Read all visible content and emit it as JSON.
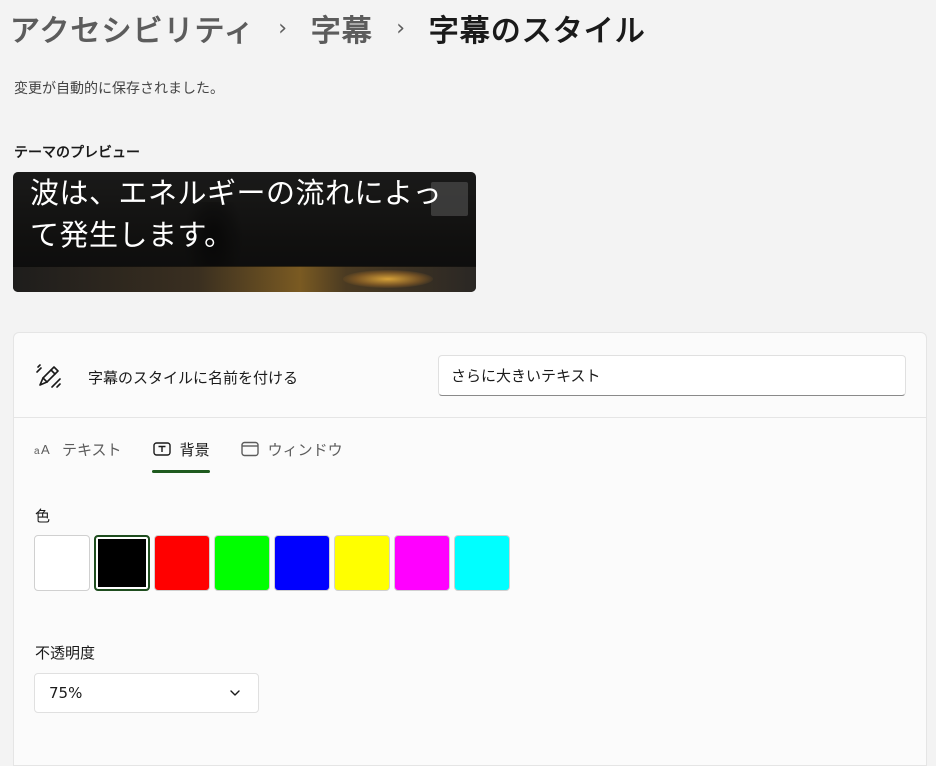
{
  "breadcrumb": {
    "items": [
      "アクセシビリティ",
      "字幕"
    ],
    "current": "字幕のスタイル",
    "separator": "›"
  },
  "status": {
    "saved_message": "変更が自動的に保存されました。"
  },
  "preview": {
    "label": "テーマのプレビュー",
    "caption_text": "波は、エネルギーの流れによって発生します。"
  },
  "style_name": {
    "label": "字幕のスタイルに名前を付ける",
    "value": "さらに大きいテキスト",
    "icon": "pen-sparkle-icon"
  },
  "tabs": [
    {
      "label": "テキスト",
      "icon": "text-aa-icon",
      "active": false
    },
    {
      "label": "背景",
      "icon": "text-box-icon",
      "active": true
    },
    {
      "label": "ウィンドウ",
      "icon": "window-icon",
      "active": false
    }
  ],
  "background": {
    "color_label": "色",
    "colors": [
      "#ffffff",
      "#000000",
      "#ff0000",
      "#00ff00",
      "#0000ff",
      "#ffff00",
      "#ff00ff",
      "#00ffff"
    ],
    "selected_color": "#000000",
    "opacity_label": "不透明度",
    "opacity_value": "75%"
  },
  "accent_color": "#1e5a1e"
}
